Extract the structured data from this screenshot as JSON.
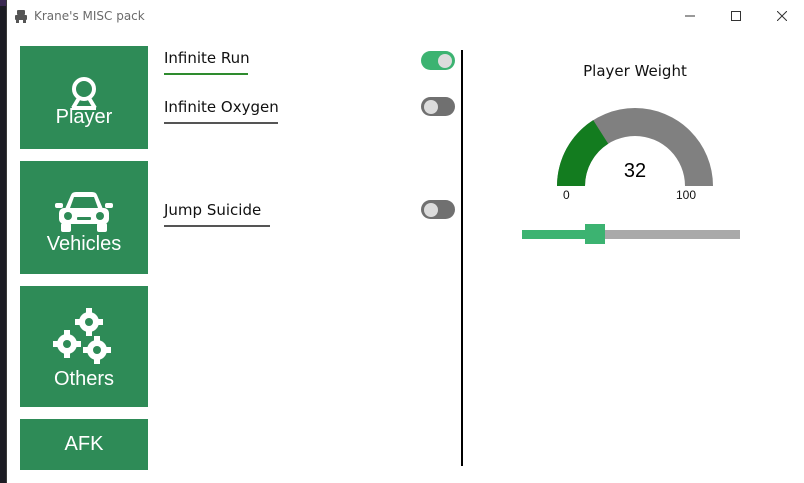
{
  "window": {
    "title": "Krane's MISC pack",
    "icon": "app-icon"
  },
  "nav": {
    "player": {
      "label": "Player",
      "icon": "player-icon"
    },
    "vehicles": {
      "label": "Vehicles",
      "icon": "car-icon"
    },
    "others": {
      "label": "Others",
      "icon": "gears-icon"
    },
    "afk": {
      "label": "AFK"
    }
  },
  "options": [
    {
      "label": "Infinite Run",
      "enabled": true
    },
    {
      "label": "Infinite Oxygen",
      "enabled": false
    },
    {
      "label": "Jump Suicide",
      "enabled": false
    }
  ],
  "weight": {
    "title": "Player Weight",
    "value": "32",
    "min_label": "0",
    "max_label": "100",
    "min": 0,
    "max": 100,
    "current": 32
  },
  "colors": {
    "tile": "#2e8b57",
    "toggle_on": "#3cb371",
    "toggle_off": "#707070",
    "gauge_fill": "#137c1f",
    "gauge_track": "#808080",
    "slider_fill": "#3cb371",
    "slider_track": "#a9a9a9"
  }
}
